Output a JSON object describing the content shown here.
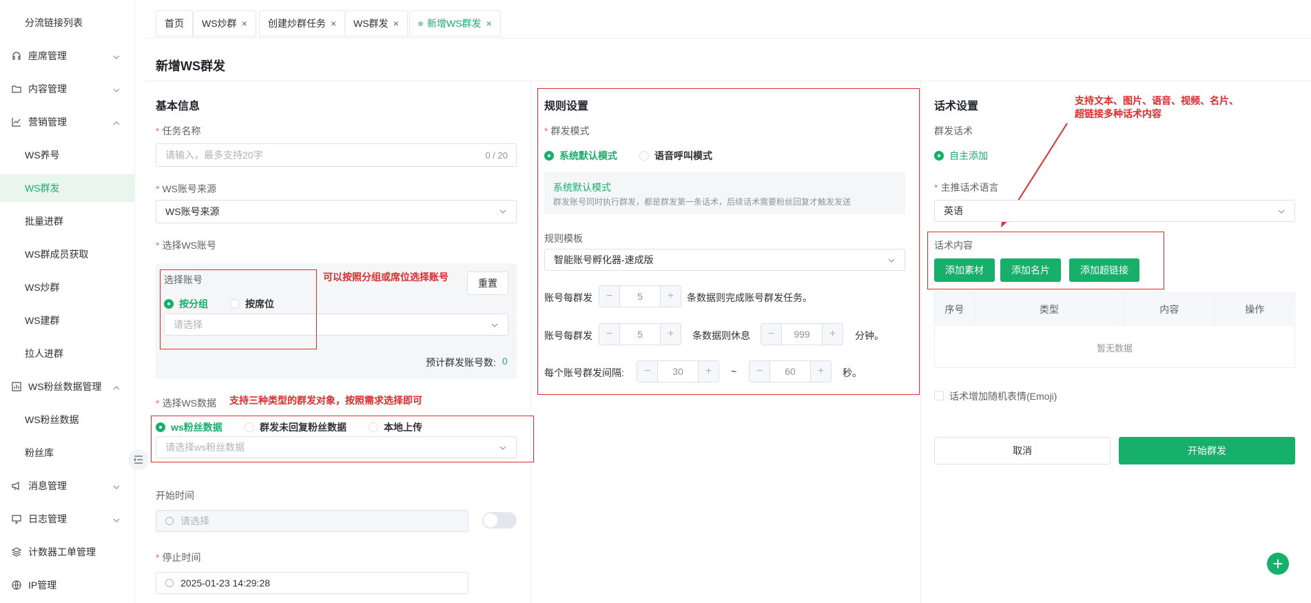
{
  "sidebar": {
    "items": [
      {
        "label": "分流链接列表",
        "type": "sub"
      },
      {
        "label": "座席管理",
        "type": "top",
        "icon": "headset-icon",
        "expanded": false
      },
      {
        "label": "内容管理",
        "type": "top",
        "icon": "folder-icon",
        "expanded": false
      },
      {
        "label": "营销管理",
        "type": "top",
        "icon": "trend-chart-icon",
        "expanded": true
      },
      {
        "label": "WS养号",
        "type": "sub"
      },
      {
        "label": "WS群发",
        "type": "sub",
        "active": true
      },
      {
        "label": "批量进群",
        "type": "sub"
      },
      {
        "label": "WS群成员获取",
        "type": "sub"
      },
      {
        "label": "WS炒群",
        "type": "sub"
      },
      {
        "label": "WS建群",
        "type": "sub"
      },
      {
        "label": "拉人进群",
        "type": "sub"
      },
      {
        "label": "WS粉丝数据管理",
        "type": "top",
        "icon": "bar-chart-icon",
        "expanded": true
      },
      {
        "label": "WS粉丝数据",
        "type": "sub"
      },
      {
        "label": "粉丝库",
        "type": "sub"
      },
      {
        "label": "消息管理",
        "type": "top",
        "icon": "megaphone-icon",
        "expanded": false
      },
      {
        "label": "日志管理",
        "type": "top",
        "icon": "monitor-icon",
        "expanded": false
      },
      {
        "label": "计数器工单管理",
        "type": "top",
        "icon": "layers-icon"
      },
      {
        "label": "IP管理",
        "type": "top",
        "icon": "globe-icon"
      }
    ]
  },
  "tabs": [
    {
      "label": "首页",
      "closable": false
    },
    {
      "label": "WS炒群",
      "closable": true
    },
    {
      "label": "创建炒群任务",
      "closable": true
    },
    {
      "label": "WS群发",
      "closable": true
    },
    {
      "label": "新增WS群发",
      "closable": true,
      "active": true
    }
  ],
  "page_title": "新增WS群发",
  "basic": {
    "title": "基本信息",
    "task_name_label": "任务名称",
    "task_name_placeholder": "请输入，最多支持20字",
    "task_name_counter": "0 / 20",
    "source_label": "WS账号来源",
    "source_value": "WS账号来源",
    "select_account_label": "选择WS账号",
    "choose_account_label": "选择账号",
    "reset_button": "重置",
    "radio_group": "按分组",
    "radio_seat": "按席位",
    "select_placeholder": "请选择",
    "estimate_label": "预计群发账号数:",
    "estimate_value": "0",
    "select_data_label": "选择WS数据",
    "data_radio_1": "ws粉丝数据",
    "data_radio_2": "群发未回复粉丝数据",
    "data_radio_3": "本地上传",
    "data_placeholder": "请选择ws粉丝数据",
    "start_label": "开始时间",
    "start_placeholder": "请选择",
    "stop_label": "停止时间",
    "stop_value": "2025-01-23 14:29:28"
  },
  "annotations": {
    "account": "可以按照分组或席位选择账号",
    "data": "支持三种类型的群发对象，按照需求选择即可",
    "script_line1": "支持文本、图片、语音、视频、名片、",
    "script_line2": "超链接多种话术内容"
  },
  "rules": {
    "title": "规则设置",
    "mode_label": "群发模式",
    "mode_default": "系统默认模式",
    "mode_voice": "语音呼叫模式",
    "info_title": "系统默认模式",
    "info_desc": "群发账号同时执行群发，都是群发第一条话术，后续话术需要粉丝回复才触发发送",
    "template_label": "规则模板",
    "template_value": "智能账号孵化器-速成版",
    "row1_prefix": "账号每群发",
    "row1_value": "5",
    "row1_suffix": "条数据则完成账号群发任务。",
    "row2_prefix": "账号每群发",
    "row2_value": "5",
    "row2_mid": "条数据则休息",
    "row2_value2": "999",
    "row2_suffix": "分钟。",
    "row3_prefix": "每个账号群发间隔:",
    "row3_min": "30",
    "row3_tilde": "~",
    "row3_max": "60",
    "row3_suffix": "秒。"
  },
  "script": {
    "title": "话术设置",
    "mode_label": "群发话术",
    "mode_value": "自主添加",
    "lang_label": "主推话术语言",
    "lang_value": "英语",
    "content_label": "话术内容",
    "btn_material": "添加素材",
    "btn_card": "添加名片",
    "btn_link": "添加超链接",
    "table_headers": [
      "序号",
      "类型",
      "内容",
      "操作"
    ],
    "empty_text": "暂无数据",
    "emoji_label": "话术增加随机表情(Emoji)",
    "cancel_button": "取消",
    "start_button": "开始群发"
  },
  "colors": {
    "primary": "#17b06b",
    "annotation": "#e32b2b"
  }
}
